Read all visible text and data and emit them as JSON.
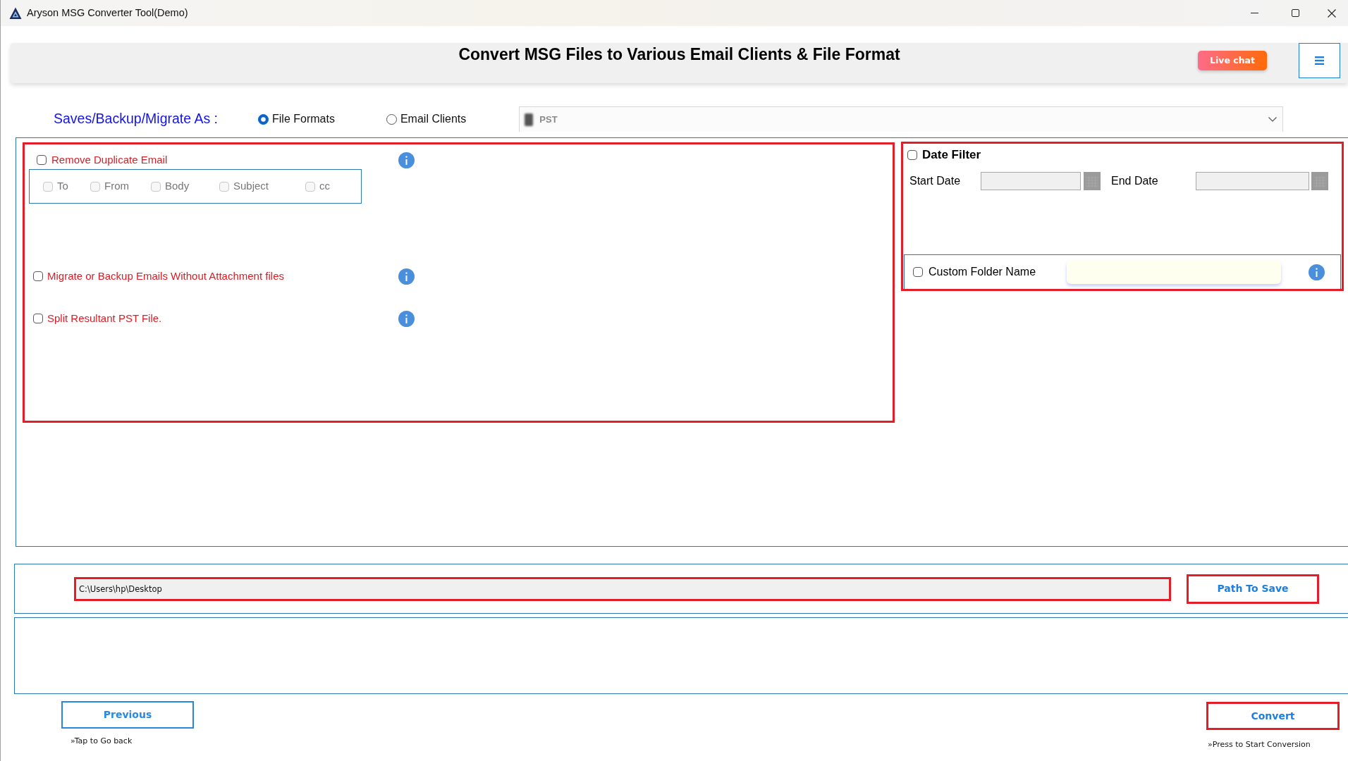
{
  "window": {
    "title": "Aryson MSG Converter Tool(Demo)"
  },
  "header": {
    "title": "Convert MSG Files to Various Email Clients & File Format",
    "live_chat": "Live chat"
  },
  "save_as": {
    "label": "Saves/Backup/Migrate As :",
    "options": [
      {
        "label": "File Formats",
        "selected": true
      },
      {
        "label": "Email Clients",
        "selected": false
      }
    ],
    "format": {
      "value": "PST"
    }
  },
  "options": [
    {
      "kind": "grouped",
      "label": "Remove Duplicate Email",
      "checked": false,
      "fields": [
        {
          "label": "To",
          "checked": false,
          "disabled": true
        },
        {
          "label": "From",
          "checked": false,
          "disabled": true
        },
        {
          "label": "Body",
          "checked": false,
          "disabled": true
        },
        {
          "label": "Subject",
          "checked": false,
          "disabled": true
        },
        {
          "label": "cc",
          "checked": false,
          "disabled": true
        }
      ]
    },
    {
      "kind": "plain",
      "label": "Migrate or Backup Emails Without Attachment files",
      "checked": false
    },
    {
      "kind": "plain",
      "label": "Split Resultant PST File.",
      "checked": false
    }
  ],
  "date_filter": {
    "label": "Date Filter",
    "checked": false,
    "start": {
      "label": "Start Date",
      "disabled": true
    },
    "end": {
      "label": "End Date",
      "disabled": true
    }
  },
  "custom_folder": {
    "label": "Custom Folder Name",
    "checked": false
  },
  "destination": {
    "path": "C:\\Users\\hp\\Desktop",
    "button": "Path To Save"
  },
  "navigation": {
    "previous": {
      "label": "Previous",
      "hint": "»Tap to Go back"
    },
    "convert": {
      "label": "Convert",
      "hint": "»Press to Start Conversion"
    }
  }
}
